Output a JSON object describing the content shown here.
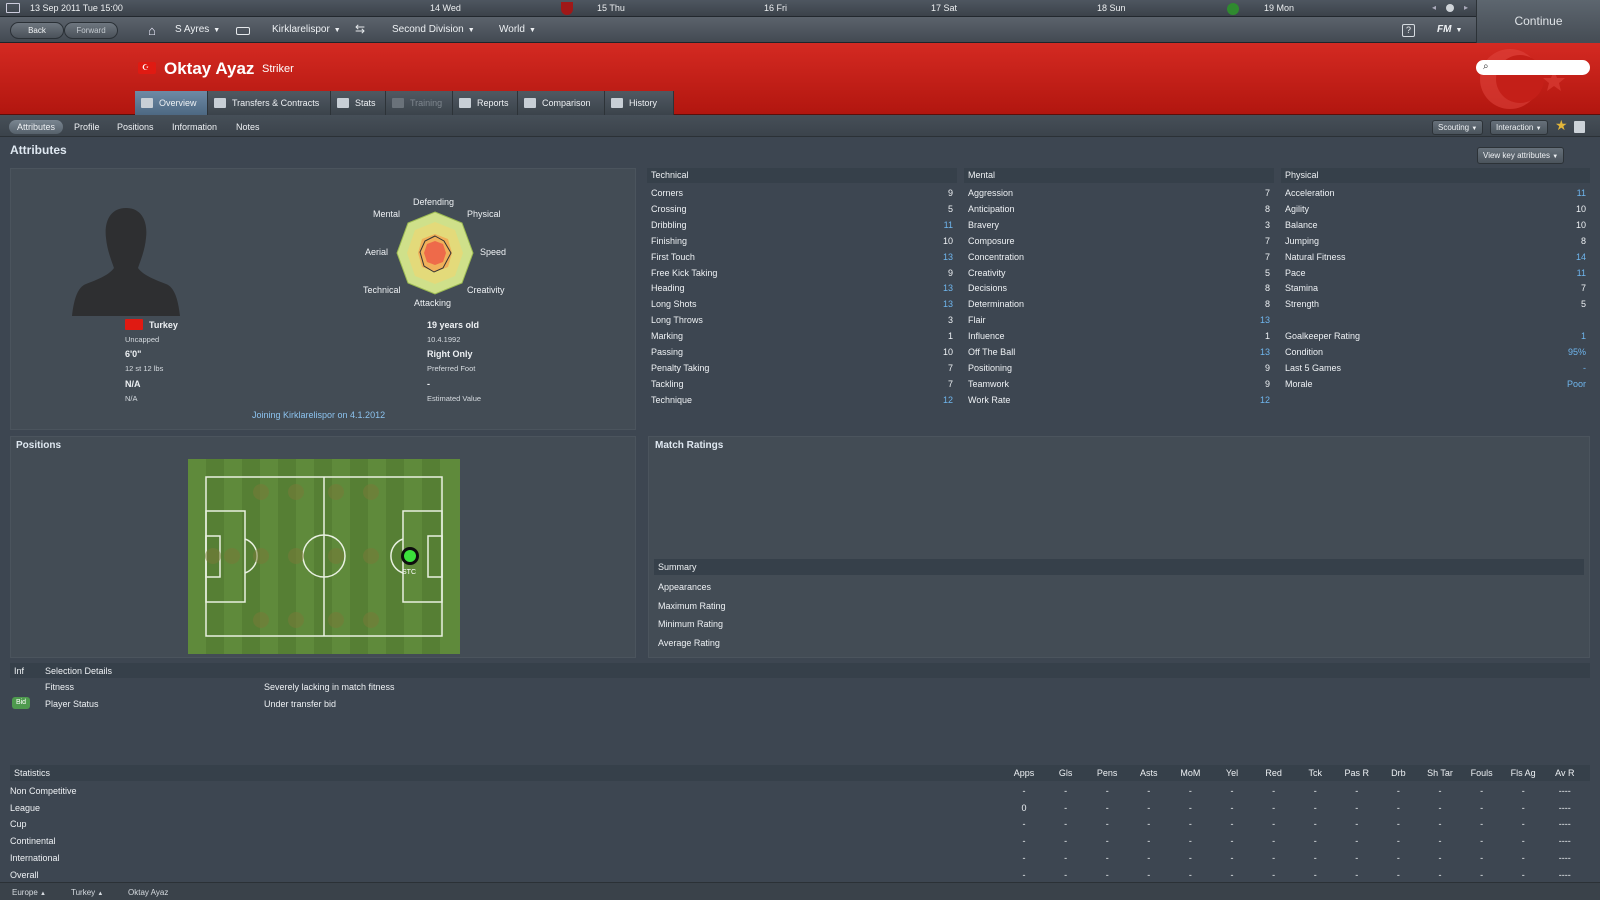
{
  "topbar": {
    "date": "13 Sep 2011 Tue 15:00",
    "days": [
      "14 Wed",
      "15 Thu",
      "16 Fri",
      "17 Sat",
      "18 Sun",
      "19 Mon"
    ],
    "continue_label": "Continue"
  },
  "nav": {
    "back": "Back",
    "forward": "Forward",
    "manager": "S Ayres",
    "club": "Kirklarelispor",
    "division": "Second Division",
    "world": "World",
    "fm": "FM"
  },
  "player": {
    "name": "Oktay Ayaz",
    "position": "Striker",
    "nation": "Turkey",
    "caps": "Uncapped",
    "height": "6'0\"",
    "weight": "12 st 12 lbs",
    "val1": "N/A",
    "val2": "N/A",
    "age": "19 years old",
    "dob": "10.4.1992",
    "foot": "Right Only",
    "foot_label": "Preferred Foot",
    "value": "-",
    "value_label": "Estimated Value",
    "joining": "Joining Kirklarelispor on 4.1.2012"
  },
  "tabs": [
    "Overview",
    "Transfers & Contracts",
    "Stats",
    "Training",
    "Reports",
    "Comparison",
    "History"
  ],
  "subtabs": [
    "Attributes",
    "Profile",
    "Positions",
    "Information",
    "Notes"
  ],
  "buttons": {
    "scouting": "Scouting",
    "interaction": "Interaction",
    "view_key": "View key attributes"
  },
  "sections": {
    "attributes": "Attributes",
    "positions": "Positions",
    "match_ratings": "Match Ratings",
    "summary": "Summary"
  },
  "radar": {
    "labels": [
      "Defending",
      "Physical",
      "Speed",
      "Creativity",
      "Attacking",
      "Technical",
      "Aerial",
      "Mental"
    ]
  },
  "technical": {
    "title": "Technical",
    "rows": [
      [
        "Corners",
        "9"
      ],
      [
        "Crossing",
        "5"
      ],
      [
        "Dribbling",
        "11"
      ],
      [
        "Finishing",
        "10"
      ],
      [
        "First Touch",
        "13"
      ],
      [
        "Free Kick Taking",
        "9"
      ],
      [
        "Heading",
        "13"
      ],
      [
        "Long Shots",
        "13"
      ],
      [
        "Long Throws",
        "3"
      ],
      [
        "Marking",
        "1"
      ],
      [
        "Passing",
        "10"
      ],
      [
        "Penalty Taking",
        "7"
      ],
      [
        "Tackling",
        "7"
      ],
      [
        "Technique",
        "12"
      ]
    ]
  },
  "mental": {
    "title": "Mental",
    "rows": [
      [
        "Aggression",
        "7"
      ],
      [
        "Anticipation",
        "8"
      ],
      [
        "Bravery",
        "3"
      ],
      [
        "Composure",
        "7"
      ],
      [
        "Concentration",
        "7"
      ],
      [
        "Creativity",
        "5"
      ],
      [
        "Decisions",
        "8"
      ],
      [
        "Determination",
        "8"
      ],
      [
        "Flair",
        "13"
      ],
      [
        "Influence",
        "1"
      ],
      [
        "Off The Ball",
        "13"
      ],
      [
        "Positioning",
        "9"
      ],
      [
        "Teamwork",
        "9"
      ],
      [
        "Work Rate",
        "12"
      ]
    ]
  },
  "physical": {
    "title": "Physical",
    "rows": [
      [
        "Acceleration",
        "11"
      ],
      [
        "Agility",
        "10"
      ],
      [
        "Balance",
        "10"
      ],
      [
        "Jumping",
        "8"
      ],
      [
        "Natural Fitness",
        "14"
      ],
      [
        "Pace",
        "11"
      ],
      [
        "Stamina",
        "7"
      ],
      [
        "Strength",
        "5"
      ]
    ],
    "extra": [
      [
        "Goalkeeper Rating",
        "1"
      ],
      [
        "Condition",
        "95%"
      ],
      [
        "Last 5 Games",
        "-"
      ],
      [
        "Morale",
        "Poor"
      ]
    ]
  },
  "pitch": {
    "position_label": "STC"
  },
  "summary_rows": [
    "Appearances",
    "Maximum Rating",
    "Minimum Rating",
    "Average Rating"
  ],
  "selection": {
    "inf": "Inf",
    "title": "Selection Details",
    "fitness_label": "Fitness",
    "fitness_value": "Severely lacking in match fitness",
    "status_badge": "Bid",
    "status_label": "Player Status",
    "status_value": "Under transfer bid"
  },
  "statistics": {
    "title": "Statistics",
    "columns": [
      "Apps",
      "Gls",
      "Pens",
      "Asts",
      "MoM",
      "Yel",
      "Red",
      "Tck",
      "Pas R",
      "Drb",
      "Sh Tar",
      "Fouls",
      "Fls Ag",
      "Av R"
    ],
    "rows": [
      {
        "label": "Non Competitive",
        "values": [
          "-",
          "-",
          "-",
          "-",
          "-",
          "-",
          "-",
          "-",
          "-",
          "-",
          "-",
          "-",
          "-",
          "----"
        ]
      },
      {
        "label": "League",
        "values": [
          "0",
          "-",
          "-",
          "-",
          "-",
          "-",
          "-",
          "-",
          "-",
          "-",
          "-",
          "-",
          "-",
          "----"
        ]
      },
      {
        "label": "Cup",
        "values": [
          "-",
          "-",
          "-",
          "-",
          "-",
          "-",
          "-",
          "-",
          "-",
          "-",
          "-",
          "-",
          "-",
          "----"
        ]
      },
      {
        "label": "Continental",
        "values": [
          "-",
          "-",
          "-",
          "-",
          "-",
          "-",
          "-",
          "-",
          "-",
          "-",
          "-",
          "-",
          "-",
          "----"
        ]
      },
      {
        "label": "International",
        "values": [
          "-",
          "-",
          "-",
          "-",
          "-",
          "-",
          "-",
          "-",
          "-",
          "-",
          "-",
          "-",
          "-",
          "----"
        ]
      },
      {
        "label": "Overall",
        "values": [
          "-",
          "-",
          "-",
          "-",
          "-",
          "-",
          "-",
          "-",
          "-",
          "-",
          "-",
          "-",
          "-",
          "----"
        ]
      }
    ]
  },
  "footer": [
    "Europe",
    "Turkey",
    "Oktay Ayaz"
  ]
}
